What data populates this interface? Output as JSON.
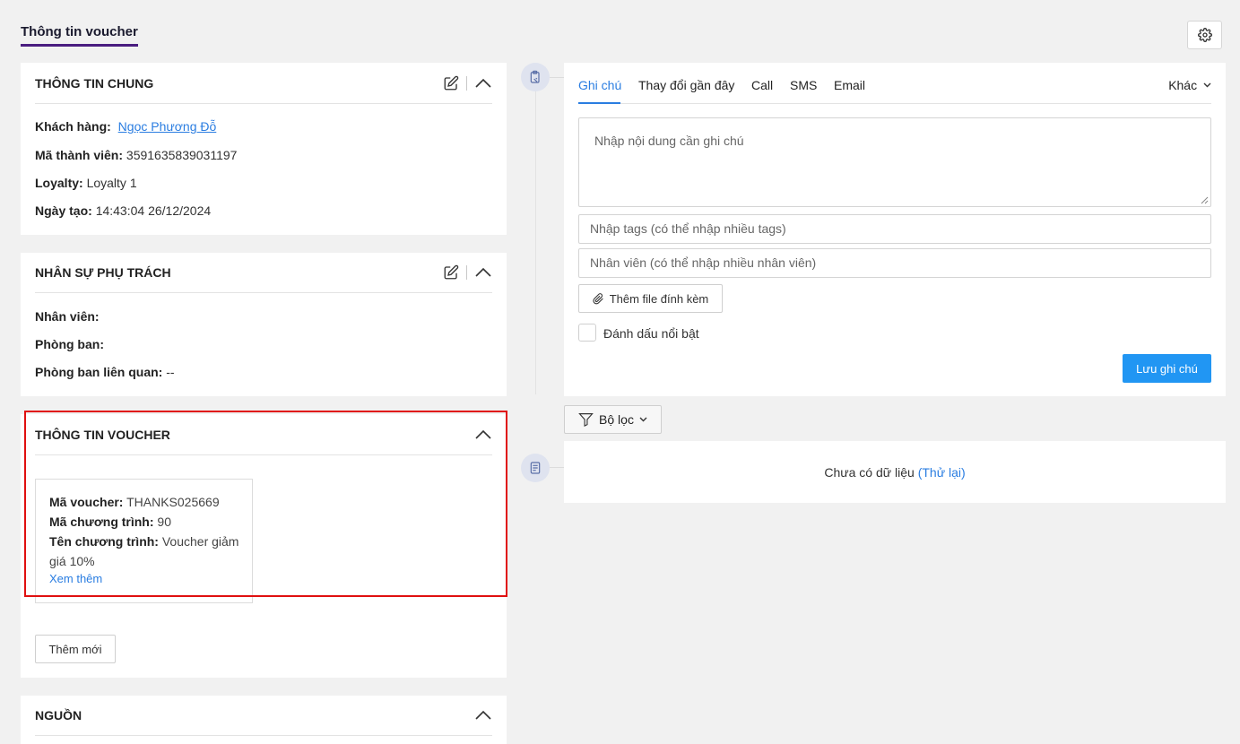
{
  "page_tab": "Thông tin voucher",
  "general": {
    "title": "THÔNG TIN CHUNG",
    "customer_label": "Khách hàng:",
    "customer_value": "Ngọc Phương Đỗ",
    "member_code_label": "Mã thành viên:",
    "member_code_value": "3591635839031197",
    "loyalty_label": "Loyalty:",
    "loyalty_value": "Loyalty 1",
    "created_label": "Ngày tạo:",
    "created_value": "14:43:04 26/12/2024"
  },
  "staff": {
    "title": "NHÂN SỰ PHỤ TRÁCH",
    "employee_label": "Nhân viên:",
    "employee_value": "",
    "department_label": "Phòng ban:",
    "department_value": "",
    "related_label": "Phòng ban liên quan:",
    "related_value": "--"
  },
  "voucher": {
    "title": "THÔNG TIN VOUCHER",
    "code_label": "Mã voucher:",
    "code_value": "THANKS025669",
    "program_code_label": "Mã chương trình:",
    "program_code_value": "90",
    "program_name_label": "Tên chương trình:",
    "program_name_value": "Voucher giảm",
    "program_name_cont": "giá 10%",
    "see_more": "Xem thêm",
    "add_new": "Thêm mới"
  },
  "source": {
    "title": "NGUỒN"
  },
  "note_panel": {
    "tabs": [
      "Ghi chú",
      "Thay đổi gần đây",
      "Call",
      "SMS",
      "Email"
    ],
    "more": "Khác",
    "note_placeholder": "Nhập nội dung cần ghi chú",
    "tags_placeholder": "Nhập tags (có thể nhập nhiều tags)",
    "staff_placeholder": "Nhân viên (có thể nhập nhiều nhân viên)",
    "attach_label": "Thêm file đính kèm",
    "highlight_label": "Đánh dấu nổi bật",
    "save_label": "Lưu ghi chú"
  },
  "filter": {
    "label": "Bộ lọc"
  },
  "activity": {
    "empty": "Chưa có dữ liệu",
    "retry": "(Thử lại)"
  },
  "colors": {
    "accent": "#2a7de1",
    "primary_button": "#2196f3",
    "tab_underline": "#4a1d80",
    "highlight_border": "#e01010"
  }
}
